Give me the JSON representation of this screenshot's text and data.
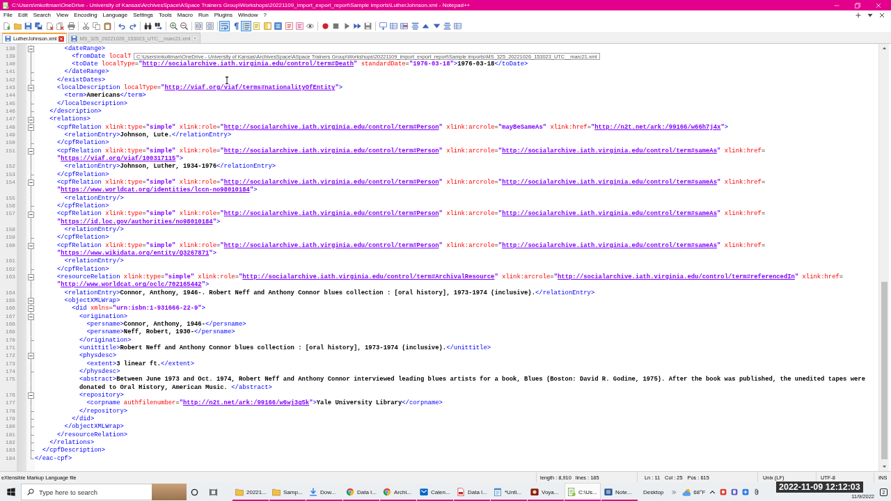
{
  "window": {
    "title": "C:\\Users\\mkottman\\OneDrive - University of Kansas\\ArchivesSpace\\ASpace Trainers Group\\Workshops\\20221109_import_export_report\\Sample imports\\LutherJohnson.xml - Notepad++"
  },
  "menu": [
    "File",
    "Edit",
    "Search",
    "View",
    "Encoding",
    "Language",
    "Settings",
    "Tools",
    "Macro",
    "Run",
    "Plugins",
    "Window",
    "?"
  ],
  "toolbar": {
    "groups": [
      [
        {
          "kind": "new",
          "on": false
        },
        {
          "kind": "open",
          "on": false
        },
        {
          "kind": "save",
          "on": false
        },
        {
          "kind": "saveall",
          "on": false
        },
        {
          "kind": "close",
          "on": false
        },
        {
          "kind": "closeall",
          "on": false
        },
        {
          "kind": "print",
          "on": false
        }
      ],
      [
        {
          "kind": "cut",
          "on": false
        },
        {
          "kind": "copy",
          "on": false
        },
        {
          "kind": "paste",
          "on": false
        }
      ],
      [
        {
          "kind": "undo",
          "on": false
        },
        {
          "kind": "redo",
          "on": false
        }
      ],
      [
        {
          "kind": "find",
          "on": false
        },
        {
          "kind": "replace",
          "on": false
        }
      ],
      [
        {
          "kind": "zoomin",
          "on": false
        },
        {
          "kind": "zoomout",
          "on": false
        }
      ],
      [
        {
          "kind": "syncv",
          "on": false
        },
        {
          "kind": "synch",
          "on": false
        }
      ],
      [
        {
          "kind": "wrap",
          "on": true
        },
        {
          "kind": "allchars",
          "on": false
        },
        {
          "kind": "indent",
          "on": true
        },
        {
          "kind": "udl",
          "on": false
        },
        {
          "kind": "docmap",
          "on": false
        },
        {
          "kind": "doclist",
          "on": false
        },
        {
          "kind": "funclist",
          "on": false
        },
        {
          "kind": "panel",
          "on": false
        },
        {
          "kind": "monitor",
          "on": false
        }
      ],
      [
        {
          "kind": "record",
          "on": false
        },
        {
          "kind": "stop",
          "on": false
        },
        {
          "kind": "play",
          "on": false
        },
        {
          "kind": "playmulti",
          "on": false
        },
        {
          "kind": "savemacro",
          "on": false
        }
      ],
      [
        {
          "kind": "comment",
          "on": false
        },
        {
          "kind": "table",
          "on": false
        },
        {
          "kind": "tablemark",
          "on": false
        },
        {
          "kind": "collapse",
          "on": false
        },
        {
          "kind": "up",
          "on": false
        },
        {
          "kind": "down",
          "on": false
        },
        {
          "kind": "expand",
          "on": false
        },
        {
          "kind": "table",
          "on": false
        }
      ]
    ]
  },
  "tabs": [
    {
      "label": "LutherJohnson.xml",
      "selected": true
    },
    {
      "label": "MS_325_20221026_153023_UTC__marc21.xml",
      "selected": false
    }
  ],
  "editor": {
    "lines": [
      {
        "number": "138",
        "kind": "start",
        "rows": [
          "        <dateRange>"
        ]
      },
      {
        "number": "139",
        "kind": "body",
        "rows": [
          "          <fromDate localT"
        ]
      },
      {
        "number": "140",
        "kind": "body",
        "rows": [
          "          <toDate localType=\"http://socialarchive.iath.virginia.edu/control/term#Death\" standardDate=\"1976-03-18\">1976-03-18</toDate>"
        ]
      },
      {
        "number": "141",
        "kind": "end",
        "rows": [
          "        </dateRange>"
        ]
      },
      {
        "number": "142",
        "kind": "end",
        "rows": [
          "      </existDates>"
        ]
      },
      {
        "number": "143",
        "kind": "start",
        "rows": [
          "      <localDescription localType=\"http://viaf.org/viaf/terms#nationalityOfEntity\">"
        ]
      },
      {
        "number": "144",
        "kind": "body",
        "rows": [
          "        <term>Americans</term>"
        ]
      },
      {
        "number": "145",
        "kind": "end",
        "rows": [
          "      </localDescription>"
        ]
      },
      {
        "number": "146",
        "kind": "end",
        "rows": [
          "    </description>"
        ]
      },
      {
        "number": "147",
        "kind": "start",
        "rows": [
          "    <relations>"
        ]
      },
      {
        "number": "148",
        "kind": "start",
        "rows": [
          "      <cpfRelation xlink:type=\"simple\" xlink:role=\"http://socialarchive.iath.virginia.edu/control/term#Person\" xlink:arcrole=\"mayBeSameAs\" xlink:href=\"http://n2t.net/ark:/99166/w66h7j4x\">"
        ]
      },
      {
        "number": "149",
        "kind": "body",
        "rows": [
          "        <relationEntry>Johnson, Lute.</relationEntry>"
        ]
      },
      {
        "number": "150",
        "kind": "end",
        "rows": [
          "      </cpfRelation>"
        ]
      },
      {
        "number": "151",
        "kind": "start",
        "rows": [
          "      <cpfRelation xlink:type=\"simple\" xlink:role=\"http://socialarchive.iath.virginia.edu/control/term#Person\" xlink:arcrole=\"http://socialarchive.iath.virginia.edu/control/term#sameAs\" xlink:href=",
          "\"https://viaf.org/viaf/100317115\">"
        ]
      },
      {
        "number": "152",
        "kind": "body",
        "rows": [
          "        <relationEntry>Johnson, Luther, 1934-1976</relationEntry>"
        ]
      },
      {
        "number": "153",
        "kind": "end",
        "rows": [
          "      </cpfRelation>"
        ]
      },
      {
        "number": "154",
        "kind": "start",
        "rows": [
          "      <cpfRelation xlink:type=\"simple\" xlink:role=\"http://socialarchive.iath.virginia.edu/control/term#Person\" xlink:arcrole=\"http://socialarchive.iath.virginia.edu/control/term#sameAs\" xlink:href=",
          "\"https://www.worldcat.org/identities/lccn-no98010184\">"
        ]
      },
      {
        "number": "155",
        "kind": "body",
        "rows": [
          "        <relationEntry/>"
        ]
      },
      {
        "number": "156",
        "kind": "end",
        "rows": [
          "      </cpfRelation>"
        ]
      },
      {
        "number": "157",
        "kind": "start",
        "rows": [
          "      <cpfRelation xlink:type=\"simple\" xlink:role=\"http://socialarchive.iath.virginia.edu/control/term#Person\" xlink:arcrole=\"http://socialarchive.iath.virginia.edu/control/term#sameAs\" xlink:href=",
          "\"https://id.loc.gov/authorities/no98010184\">"
        ]
      },
      {
        "number": "158",
        "kind": "body",
        "rows": [
          "        <relationEntry/>"
        ]
      },
      {
        "number": "159",
        "kind": "end",
        "rows": [
          "      </cpfRelation>"
        ]
      },
      {
        "number": "160",
        "kind": "start",
        "rows": [
          "      <cpfRelation xlink:type=\"simple\" xlink:role=\"http://socialarchive.iath.virginia.edu/control/term#Person\" xlink:arcrole=\"http://socialarchive.iath.virginia.edu/control/term#sameAs\" xlink:href=",
          "\"https://www.wikidata.org/entity/Q3267871\">"
        ]
      },
      {
        "number": "161",
        "kind": "body",
        "rows": [
          "        <relationEntry/>"
        ]
      },
      {
        "number": "162",
        "kind": "end",
        "rows": [
          "      </cpfRelation>"
        ]
      },
      {
        "number": "163",
        "kind": "start",
        "rows": [
          "      <resourceRelation xlink:type=\"simple\" xlink:role=\"http://socialarchive.iath.virginia.edu/control/term#ArchivalResource\" xlink:arcrole=\"http://socialarchive.iath.virginia.edu/control/term#referencedIn\" xlink:href=",
          "\"http://www.worldcat.org/oclc/702165442\">"
        ]
      },
      {
        "number": "164",
        "kind": "body",
        "rows": [
          "        <relationEntry>Connor, Anthony, 1946-. Robert Neff and Anthony Connor blues collection : [oral history], 1973-1974 (inclusive).</relationEntry>"
        ]
      },
      {
        "number": "165",
        "kind": "start",
        "rows": [
          "        <objectXMLWrap>"
        ]
      },
      {
        "number": "166",
        "kind": "start",
        "rows": [
          "          <did xmlns=\"urn:isbn:1-931666-22-9\">"
        ]
      },
      {
        "number": "167",
        "kind": "start",
        "rows": [
          "            <origination>"
        ]
      },
      {
        "number": "168",
        "kind": "body",
        "rows": [
          "              <persname>Connor, Anthony, 1946-</persname>"
        ]
      },
      {
        "number": "169",
        "kind": "body",
        "rows": [
          "              <persname>Neff, Robert, 1930-</persname>"
        ]
      },
      {
        "number": "170",
        "kind": "end",
        "rows": [
          "            </origination>"
        ]
      },
      {
        "number": "171",
        "kind": "body",
        "rows": [
          "            <unittitle>Robert Neff and Anthony Connor blues collection : [oral history], 1973-1974 (inclusive).</unittitle>"
        ]
      },
      {
        "number": "172",
        "kind": "start",
        "rows": [
          "            <physdesc>"
        ]
      },
      {
        "number": "173",
        "kind": "body",
        "rows": [
          "              <extent>3 linear ft.</extent>"
        ]
      },
      {
        "number": "174",
        "kind": "end",
        "rows": [
          "            </physdesc>"
        ]
      },
      {
        "number": "175",
        "kind": "body",
        "rows": [
          "            <abstract>Between June 1973 and Oct. 1974, Robert Neff and Anthony Connor interviewed leading blues artists for a book, Blues (Boston: David R. Godine, 1975). After the book was published, the unedited tapes were",
          "donated to Oral History, American Music. </abstract>"
        ]
      },
      {
        "number": "176",
        "kind": "start",
        "rows": [
          "            <repository>"
        ]
      },
      {
        "number": "177",
        "kind": "body",
        "rows": [
          "              <corpname authfilenumber=\"http://n2t.net/ark:/99166/w6wj3g5k\">Yale University Library</corpname>"
        ]
      },
      {
        "number": "178",
        "kind": "end",
        "rows": [
          "            </repository>"
        ]
      },
      {
        "number": "179",
        "kind": "end",
        "rows": [
          "          </did>"
        ]
      },
      {
        "number": "180",
        "kind": "end",
        "rows": [
          "        </objectXMLWrap>"
        ]
      },
      {
        "number": "181",
        "kind": "end",
        "rows": [
          "      </resourceRelation>"
        ]
      },
      {
        "number": "182",
        "kind": "end",
        "rows": [
          "    </relations>"
        ]
      },
      {
        "number": "183",
        "kind": "end",
        "rows": [
          "  </cpfDescription>"
        ]
      },
      {
        "number": "184",
        "kind": "last",
        "rows": [
          "</eac-cpf>"
        ]
      }
    ],
    "tooltip": "C:\\Users\\mkottman\\OneDrive - University of Kansas\\ArchivesSpace\\ASpace Trainers Group\\Workshops\\20221109_import_export_report\\Sample imports\\MS_325_20221026_153023_UTC__marc21.xml"
  },
  "status_bar": {
    "document_type": "eXtensible Markup Language file",
    "length": "length : 8,910",
    "lines": "lines : 185",
    "ln": "Ln : 11",
    "col": "Col : 25",
    "pos": "Pos : 615",
    "eol": "Unix (LF)",
    "encoding": "UTF-8",
    "mode": "INS"
  },
  "taskbar": {
    "search": {
      "placeholder": "Type here to search"
    },
    "apps": [
      {
        "kind": "folder",
        "label": "20221...",
        "selected": false
      },
      {
        "kind": "folder",
        "label": "Samp...",
        "selected": false
      },
      {
        "kind": "download",
        "label": "Dow...",
        "selected": false
      },
      {
        "kind": "browser",
        "label": "Data I...",
        "selected": false
      },
      {
        "kind": "browser",
        "label": "Archi...",
        "selected": false
      },
      {
        "kind": "mail",
        "label": "Calen...",
        "selected": false
      },
      {
        "kind": "pdf",
        "label": "Data I...",
        "selected": false
      },
      {
        "kind": "notepad",
        "label": "*Unti...",
        "selected": false
      },
      {
        "kind": "media",
        "label": "Voya...",
        "selected": false
      },
      {
        "kind": "editor",
        "label": "C:\\Us...",
        "selected": true
      },
      {
        "kind": "word",
        "label": "Note...",
        "selected": false
      }
    ],
    "desktop": "Desktop",
    "weather": "68°F",
    "date": "11/9/2022",
    "notifications": "2"
  },
  "overlay": {
    "timestamp": "2022-11-09 12:12:03"
  }
}
